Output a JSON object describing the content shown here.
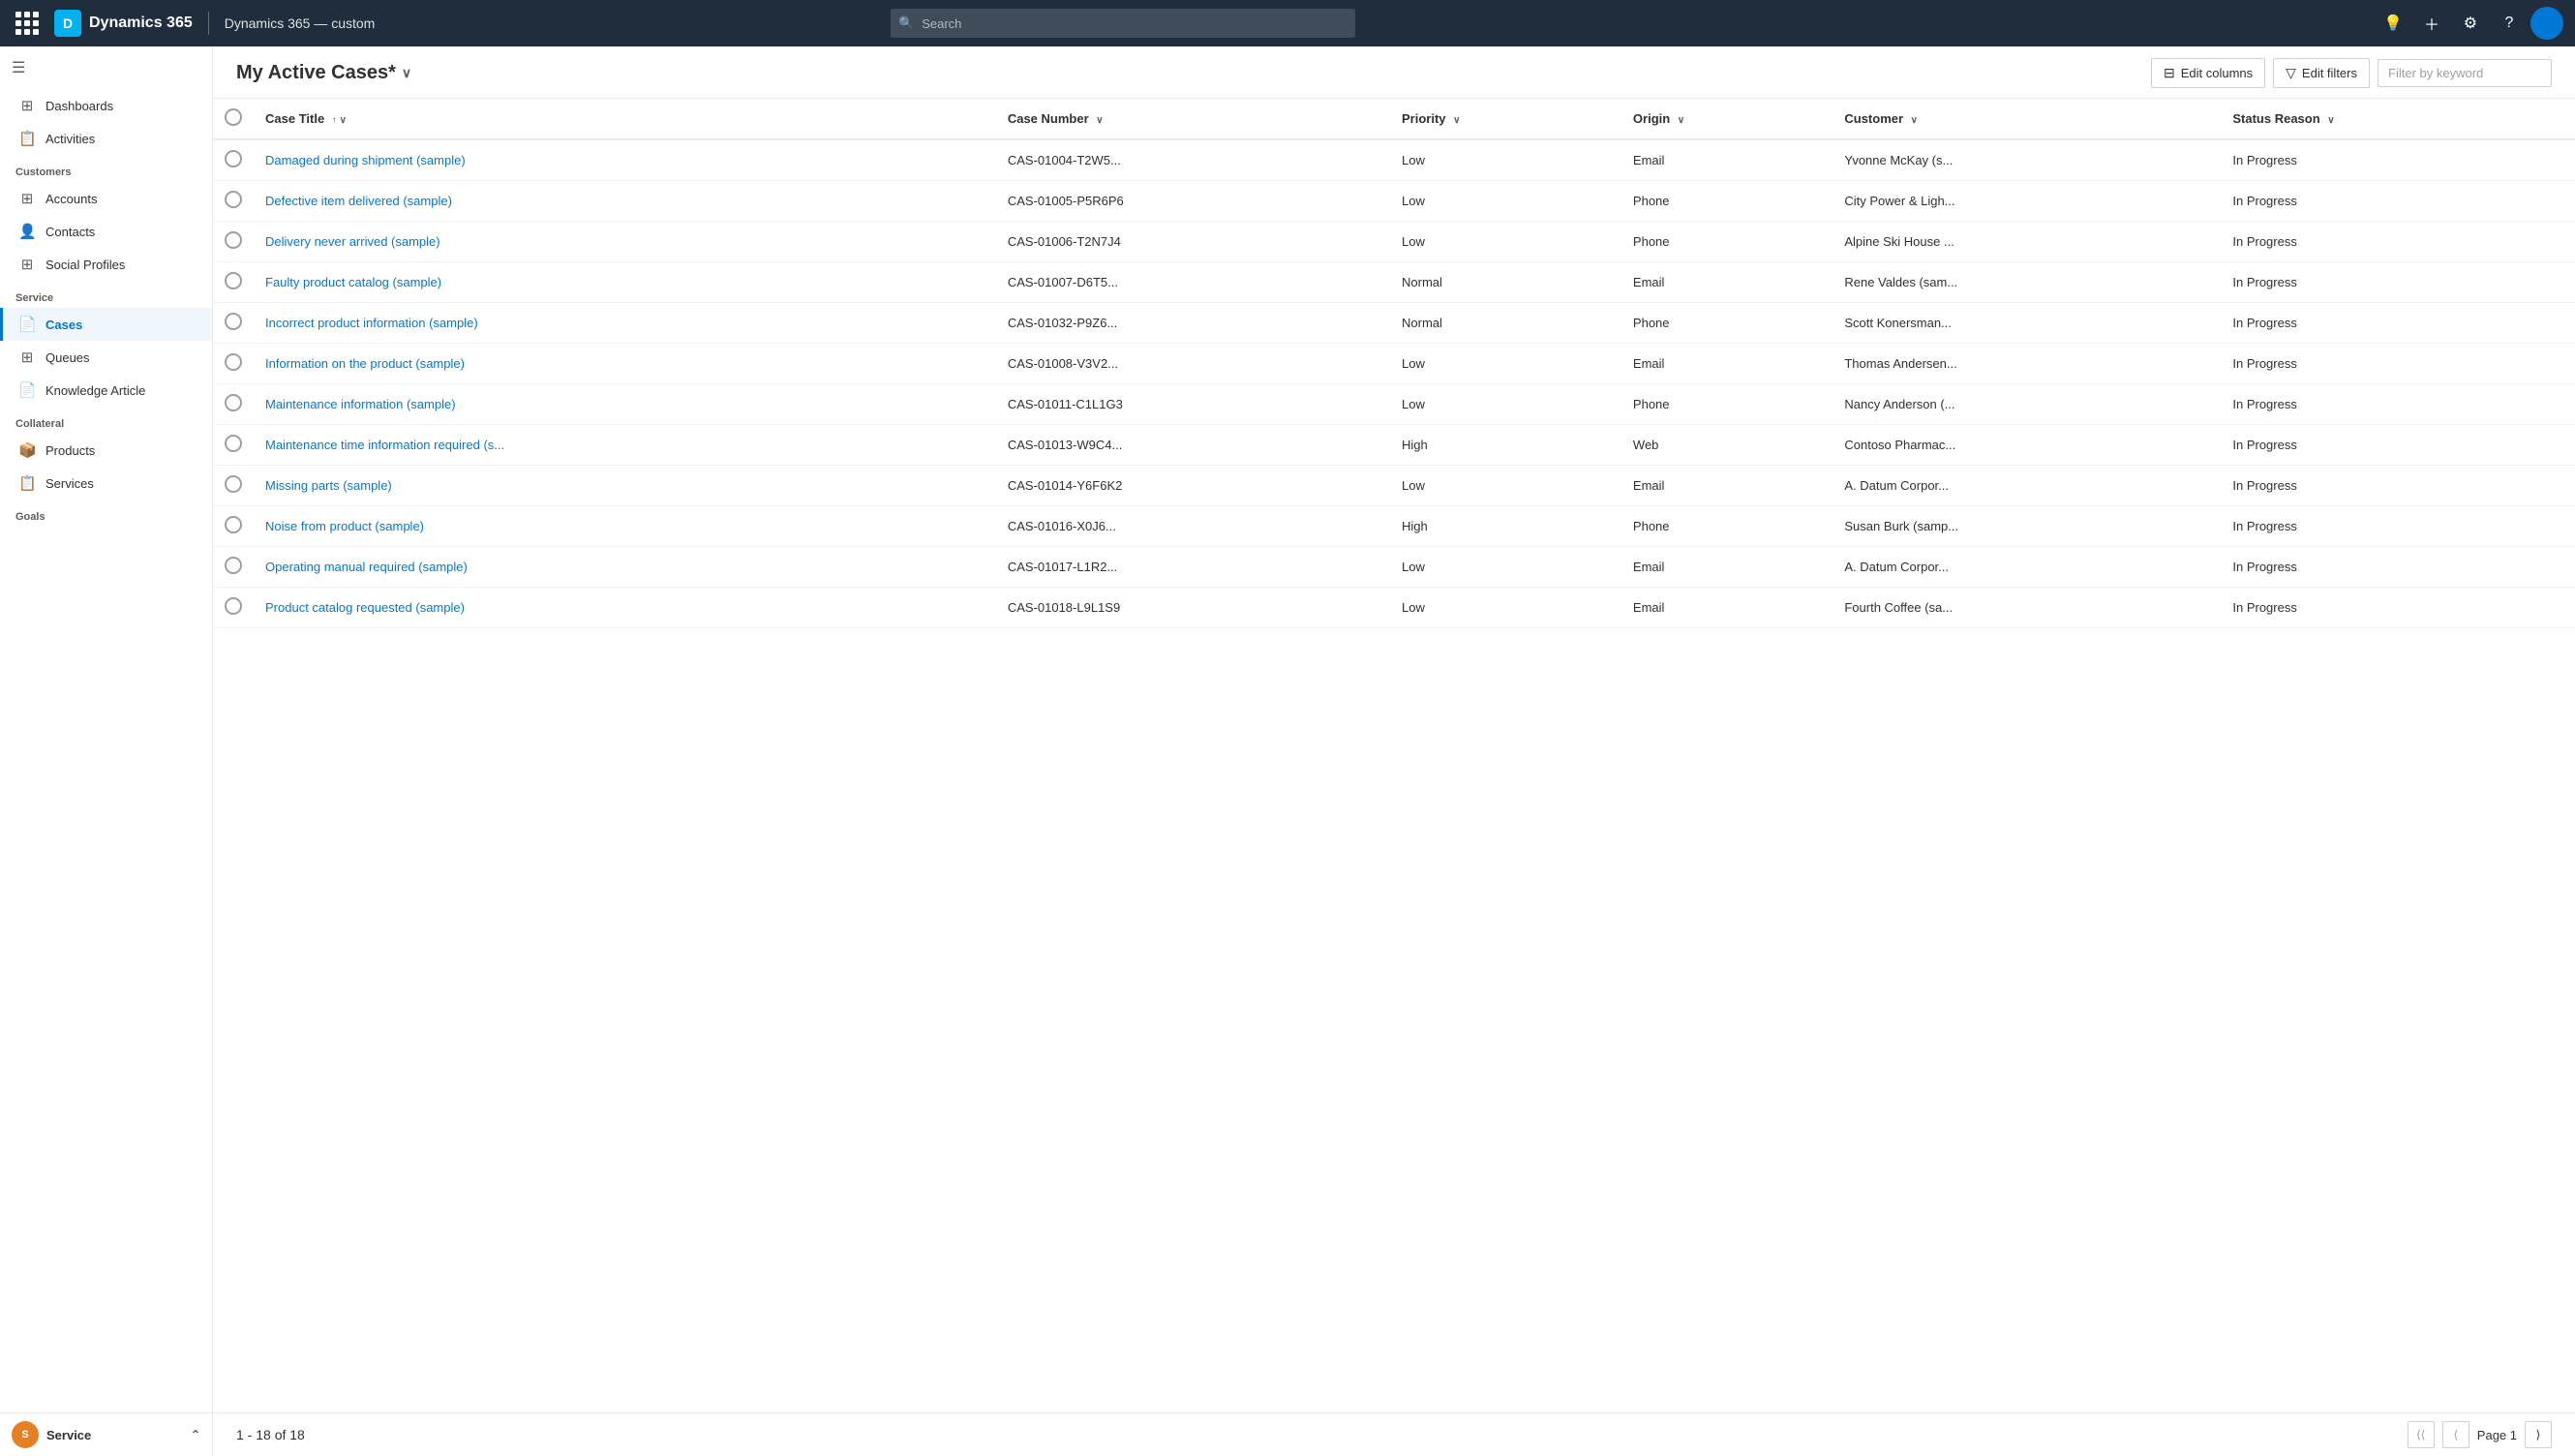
{
  "topnav": {
    "app_name": "Dynamics 365",
    "app_instance": "Dynamics 365 — custom",
    "search_placeholder": "Search",
    "buttons": {
      "lightbulb": "💡",
      "plus": "+",
      "settings": "⚙",
      "help": "?",
      "avatar_initials": ""
    }
  },
  "sidebar": {
    "hamburger_label": "☰",
    "items": [
      {
        "label": "Dashboards",
        "icon": "▦",
        "active": false,
        "section": null
      },
      {
        "label": "Activities",
        "icon": "📋",
        "active": false,
        "section": null
      },
      {
        "label": "Accounts",
        "icon": "▦",
        "active": false,
        "section": "Customers"
      },
      {
        "label": "Contacts",
        "icon": "👤",
        "active": false,
        "section": null
      },
      {
        "label": "Social Profiles",
        "icon": "▦",
        "active": false,
        "section": null
      },
      {
        "label": "Cases",
        "icon": "📄",
        "active": true,
        "section": "Service"
      },
      {
        "label": "Queues",
        "icon": "▦",
        "active": false,
        "section": null
      },
      {
        "label": "Knowledge Article",
        "icon": "📄",
        "active": false,
        "section": null
      },
      {
        "label": "Products",
        "icon": "📦",
        "active": false,
        "section": "Collateral"
      },
      {
        "label": "Services",
        "icon": "📋",
        "active": false,
        "section": null
      }
    ],
    "goals_section": "Goals",
    "footer_label": "Service",
    "footer_initials": "S"
  },
  "view": {
    "title": "My Active Cases*",
    "edit_columns_label": "Edit columns",
    "edit_filters_label": "Edit filters",
    "filter_placeholder": "Filter by keyword",
    "record_count": "1 - 18 of 18",
    "page_label": "Page 1"
  },
  "table": {
    "columns": [
      {
        "label": "Case Title",
        "sort": "↑",
        "has_dropdown": true
      },
      {
        "label": "Case Number",
        "sort": "",
        "has_dropdown": true
      },
      {
        "label": "Priority",
        "sort": "",
        "has_dropdown": true
      },
      {
        "label": "Origin",
        "sort": "",
        "has_dropdown": true
      },
      {
        "label": "Customer",
        "sort": "",
        "has_dropdown": true
      },
      {
        "label": "Status Reason",
        "sort": "",
        "has_dropdown": true
      }
    ],
    "rows": [
      {
        "title": "Damaged during shipment (sample)",
        "number": "CAS-01004-T2W5...",
        "priority": "Low",
        "origin": "Email",
        "customer": "Yvonne McKay (s...",
        "status": "In Progress"
      },
      {
        "title": "Defective item delivered (sample)",
        "number": "CAS-01005-P5R6P6",
        "priority": "Low",
        "origin": "Phone",
        "customer": "City Power & Ligh...",
        "status": "In Progress"
      },
      {
        "title": "Delivery never arrived (sample)",
        "number": "CAS-01006-T2N7J4",
        "priority": "Low",
        "origin": "Phone",
        "customer": "Alpine Ski House ...",
        "status": "In Progress"
      },
      {
        "title": "Faulty product catalog (sample)",
        "number": "CAS-01007-D6T5...",
        "priority": "Normal",
        "origin": "Email",
        "customer": "Rene Valdes (sam...",
        "status": "In Progress"
      },
      {
        "title": "Incorrect product information (sample)",
        "number": "CAS-01032-P9Z6...",
        "priority": "Normal",
        "origin": "Phone",
        "customer": "Scott Konersman...",
        "status": "In Progress"
      },
      {
        "title": "Information on the product (sample)",
        "number": "CAS-01008-V3V2...",
        "priority": "Low",
        "origin": "Email",
        "customer": "Thomas Andersen...",
        "status": "In Progress"
      },
      {
        "title": "Maintenance information (sample)",
        "number": "CAS-01011-C1L1G3",
        "priority": "Low",
        "origin": "Phone",
        "customer": "Nancy Anderson (...",
        "status": "In Progress"
      },
      {
        "title": "Maintenance time information required (s...",
        "number": "CAS-01013-W9C4...",
        "priority": "High",
        "origin": "Web",
        "customer": "Contoso Pharmac...",
        "status": "In Progress"
      },
      {
        "title": "Missing parts (sample)",
        "number": "CAS-01014-Y6F6K2",
        "priority": "Low",
        "origin": "Email",
        "customer": "A. Datum Corpor...",
        "status": "In Progress"
      },
      {
        "title": "Noise from product (sample)",
        "number": "CAS-01016-X0J6...",
        "priority": "High",
        "origin": "Phone",
        "customer": "Susan Burk (samp...",
        "status": "In Progress"
      },
      {
        "title": "Operating manual required (sample)",
        "number": "CAS-01017-L1R2...",
        "priority": "Low",
        "origin": "Email",
        "customer": "A. Datum Corpor...",
        "status": "In Progress"
      },
      {
        "title": "Product catalog requested (sample)",
        "number": "CAS-01018-L9L1S9",
        "priority": "Low",
        "origin": "Email",
        "customer": "Fourth Coffee (sa...",
        "status": "In Progress"
      }
    ]
  }
}
